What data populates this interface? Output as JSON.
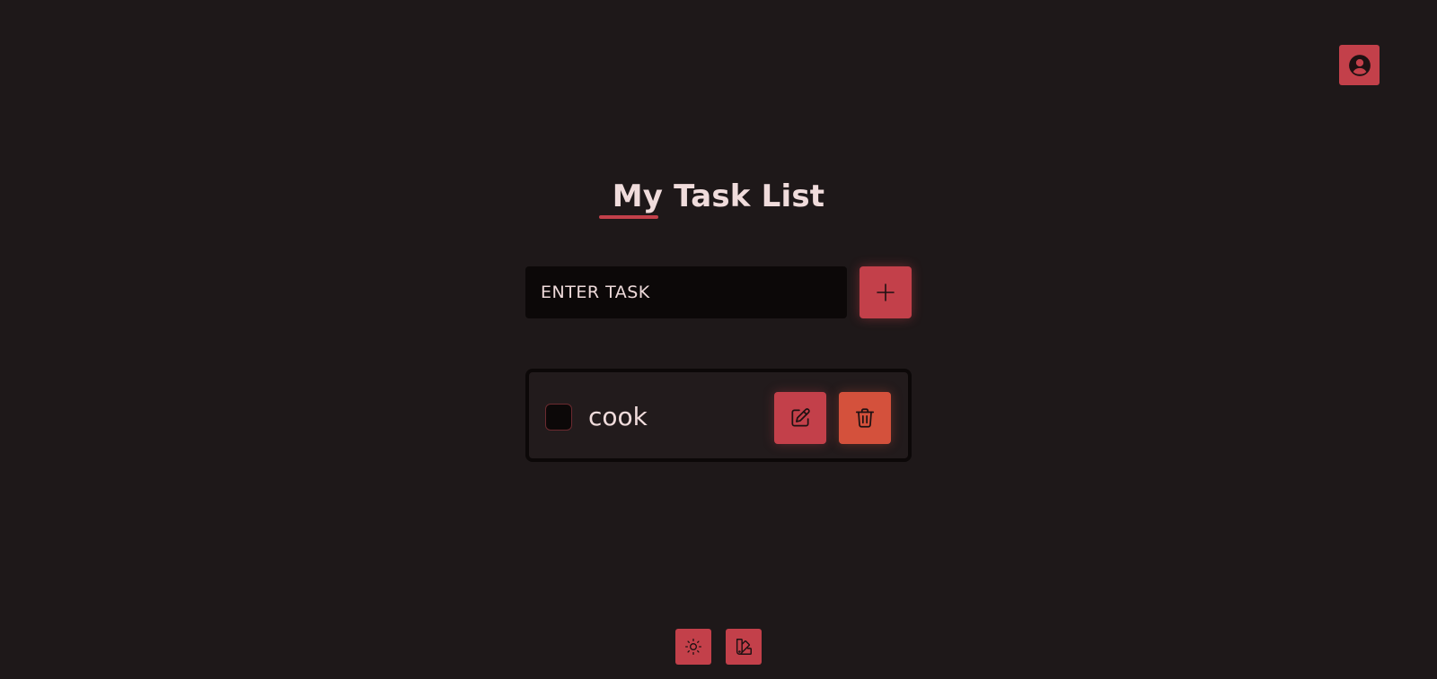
{
  "header": {
    "title": "My Task List",
    "profile_icon": "user-circle-icon"
  },
  "task_form": {
    "input_placeholder": "ENTER TASK",
    "input_value": "",
    "add_icon": "plus-icon"
  },
  "tasks": [
    {
      "text": "cook",
      "completed": false,
      "edit_icon": "pencil-square-icon",
      "delete_icon": "trash-icon"
    }
  ],
  "footer": {
    "theme_icon": "sun-icon",
    "palette_icon": "swatch-book-icon"
  },
  "colors": {
    "background": "#1e1819",
    "accent": "#c3404a",
    "delete_accent": "#d4513c",
    "input_background": "#0c0808",
    "text": "#f0dcdc"
  }
}
